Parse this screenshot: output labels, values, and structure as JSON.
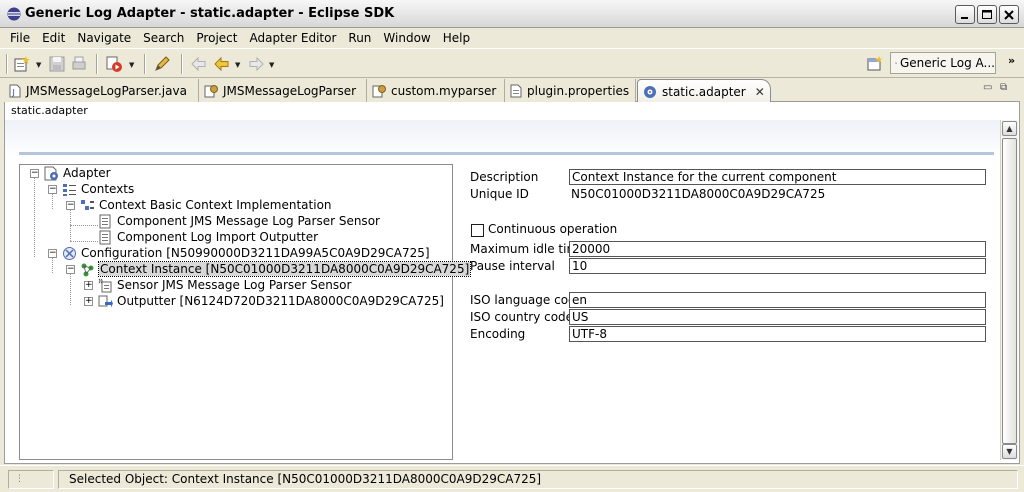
{
  "window": {
    "title": "Generic Log Adapter - static.adapter - Eclipse SDK",
    "app_icon": "eclipse-icon"
  },
  "menu": [
    "File",
    "Edit",
    "Navigate",
    "Search",
    "Project",
    "Adapter Editor",
    "Run",
    "Window",
    "Help"
  ],
  "toolbar": {
    "icons": [
      "new-wizard-icon",
      "save-icon",
      "print-icon",
      "run-icon",
      "pen-icon",
      "back-history-icon",
      "back-icon",
      "forward-icon"
    ],
    "perspective_label": "Generic Log A...",
    "more": "»"
  },
  "tabs": [
    {
      "label": "JMSMessageLogParser.java",
      "icon": "java-file-icon",
      "active": false
    },
    {
      "label": "JMSMessageLogParser",
      "icon": "parser-icon",
      "active": false
    },
    {
      "label": "custom.myparser",
      "icon": "parser-icon",
      "active": false
    },
    {
      "label": "plugin.properties",
      "icon": "text-file-icon",
      "active": false
    },
    {
      "label": "static.adapter",
      "icon": "adapter-icon",
      "active": true
    }
  ],
  "editor": {
    "header": "static.adapter"
  },
  "tree": {
    "adapter": "Adapter",
    "contexts": "Contexts",
    "context_impl": "Context Basic Context Implementation",
    "component_sensor": "Component JMS Message Log Parser Sensor",
    "component_outputter": "Component Log Import Outputter",
    "configuration": "Configuration [N50990000D3211DA99A5C0A9D29CA725]",
    "context_instance": "Context Instance [N50C01000D3211DA8000C0A9D29CA725]",
    "sensor": "Sensor JMS Message Log Parser Sensor",
    "outputter": "Outputter [N6124D720D3211DA8000C0A9D29CA725]"
  },
  "properties": {
    "description_label": "Description",
    "description_value": "Context Instance for the current component",
    "unique_id_label": "Unique ID",
    "unique_id_value": "N50C01000D3211DA8000C0A9D29CA725",
    "continuous_label": "Continuous operation",
    "continuous_checked": false,
    "max_idle_label": "Maximum idle time",
    "max_idle_value": "20000",
    "pause_label": "Pause interval",
    "pause_value": "10",
    "iso_lang_label": "ISO language code",
    "iso_lang_value": "en",
    "iso_country_label": "ISO country code",
    "iso_country_value": "US",
    "encoding_label": "Encoding",
    "encoding_value": "UTF-8"
  },
  "status": {
    "text": "Selected Object: Context Instance [N50C01000D3211DA8000C0A9D29CA725]"
  }
}
